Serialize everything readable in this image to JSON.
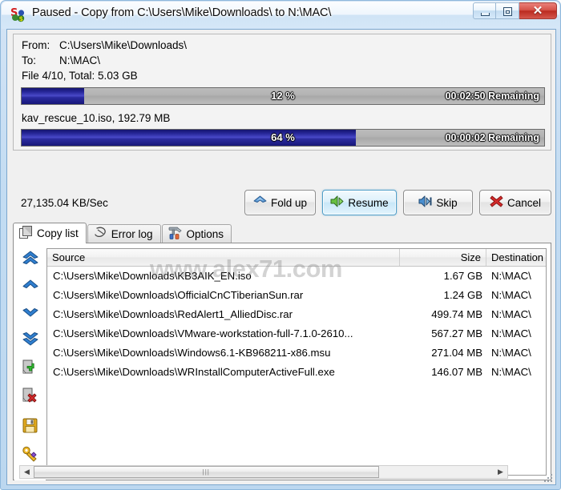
{
  "window": {
    "title": "Paused - Copy from C:\\Users\\Mike\\Downloads\\ to N:\\MAC\\",
    "icon": "supercopier-icon",
    "minimize_label": "Minimize",
    "restore_label": "Restore",
    "close_label": "Close",
    "close_glyph": "✕"
  },
  "info": {
    "from_label": "From:",
    "from_value": "C:\\Users\\Mike\\Downloads\\",
    "to_label": "To:",
    "to_value": "N:\\MAC\\",
    "total_line": "File 4/10, Total: 5.03 GB",
    "current_file": "kav_rescue_10.iso, 192.79 MB",
    "speed": "27,135.04 KB/Sec"
  },
  "progress": {
    "overall": {
      "percent_label": "12 %",
      "percent": 12,
      "remaining": "00:02:50 Remaining"
    },
    "current": {
      "percent_label": "64 %",
      "percent": 64,
      "remaining": "00:00:02 Remaining"
    },
    "fill_color": "#252596",
    "track_color": "#b2b2b2"
  },
  "buttons": [
    {
      "id": "fold-up",
      "label": "Fold up",
      "icon": "fold-up-icon",
      "highlighted": false
    },
    {
      "id": "resume",
      "label": "Resume",
      "icon": "resume-icon",
      "highlighted": true
    },
    {
      "id": "skip",
      "label": "Skip",
      "icon": "skip-icon",
      "highlighted": false
    },
    {
      "id": "cancel",
      "label": "Cancel",
      "icon": "cancel-icon",
      "highlighted": false
    }
  ],
  "tabs": [
    {
      "id": "copy-list",
      "label": "Copy list",
      "icon": "copy-list-icon",
      "active": true
    },
    {
      "id": "error-log",
      "label": "Error log",
      "icon": "error-log-icon",
      "active": false
    },
    {
      "id": "options",
      "label": "Options",
      "icon": "options-icon",
      "active": false
    }
  ],
  "sidebar": [
    {
      "id": "move-top",
      "icon": "double-chevron-up-icon"
    },
    {
      "id": "move-up",
      "icon": "chevron-up-icon"
    },
    {
      "id": "move-down",
      "icon": "chevron-down-icon"
    },
    {
      "id": "move-bottom",
      "icon": "double-chevron-down-icon"
    },
    {
      "id": "add-file",
      "icon": "file-add-icon"
    },
    {
      "id": "remove-file",
      "icon": "file-remove-icon"
    },
    {
      "id": "save-list",
      "icon": "floppy-save-icon"
    },
    {
      "id": "settings",
      "icon": "key-wrench-icon"
    }
  ],
  "list": {
    "columns": [
      "Source",
      "Size",
      "Destination"
    ],
    "rows": [
      {
        "source": "C:\\Users\\Mike\\Downloads\\KB3AIK_EN.iso",
        "size": "1.67 GB",
        "destination": "N:\\MAC\\"
      },
      {
        "source": "C:\\Users\\Mike\\Downloads\\OfficialCnCTiberianSun.rar",
        "size": "1.24 GB",
        "destination": "N:\\MAC\\"
      },
      {
        "source": "C:\\Users\\Mike\\Downloads\\RedAlert1_AlliedDisc.rar",
        "size": "499.74 MB",
        "destination": "N:\\MAC\\"
      },
      {
        "source": "C:\\Users\\Mike\\Downloads\\VMware-workstation-full-7.1.0-2610...",
        "size": "567.27 MB",
        "destination": "N:\\MAC\\"
      },
      {
        "source": "C:\\Users\\Mike\\Downloads\\Windows6.1-KB968211-x86.msu",
        "size": "271.04 MB",
        "destination": "N:\\MAC\\"
      },
      {
        "source": "C:\\Users\\Mike\\Downloads\\WRInstallComputerActiveFull.exe",
        "size": "146.07 MB",
        "destination": "N:\\MAC\\"
      }
    ]
  },
  "watermark": "www.alex71.com",
  "scrollbar": {
    "left_arrow": "◀",
    "right_arrow": "▶",
    "grip": "|||",
    "thumb_percent": 75
  }
}
